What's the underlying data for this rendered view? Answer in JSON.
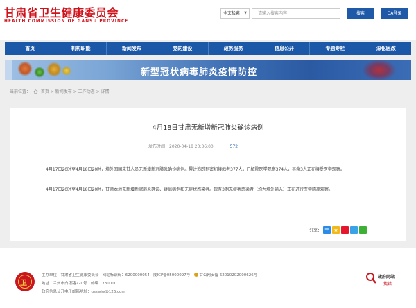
{
  "header": {
    "title": "甘肃省卫生健康委员会",
    "subtitle": "HEALTH COMMISSION OF GANSU PROVINCE",
    "search_scope": "全文检索",
    "search_placeholder": "请输入搜索内容",
    "search_button": "搜索",
    "oa_button": "OA登录"
  },
  "nav": {
    "items": [
      "首页",
      "机构职能",
      "新闻发布",
      "党的建设",
      "政务服务",
      "信息公开",
      "专题专栏",
      "深化医改"
    ]
  },
  "banner": {
    "text": "新型冠状病毒肺炎疫情防控"
  },
  "breadcrumb": {
    "label": "当前位置：",
    "items": [
      "首页",
      "新闻发布",
      "工作动态",
      "详情"
    ],
    "separator": ">"
  },
  "article": {
    "title": "4月18日甘肃无新增新冠肺炎确诊病例",
    "published_label": "发布时间：",
    "published": "2020-04-18 20:36:00",
    "views": "572",
    "para1": "4月17日20时至4月18日20时，境外回国来甘人员无新增新冠肺炎确诊病例。累计追踪到密切接触者377人，已解除医学观察374人，其余3人正在接受医学观察。",
    "para2": "4月17日20时至4月18日20时，甘肃本地无新增新冠肺炎确诊、疑似病例和无症状感染者。现有3例无症状感染者（均为境外输入）正在进行医学隔离观察。"
  },
  "share": {
    "label": "分享："
  },
  "footer": {
    "host": "主办单位：甘肃省卫生健康委员会",
    "site_code": "网站标识码：6200000054",
    "icp": "陇ICP备05000097号",
    "police": "甘公网安备 62010202000626号",
    "address": "地址：兰州市白银路220号",
    "postcode": "邮编：730000",
    "email": "政府信息公开电子邮箱地址：gsswjw@126.com",
    "error_title": "政府网站",
    "error_sub": "找错"
  },
  "colors": {
    "brand_red": "#d0121b",
    "nav_blue": "#1c58a8"
  }
}
